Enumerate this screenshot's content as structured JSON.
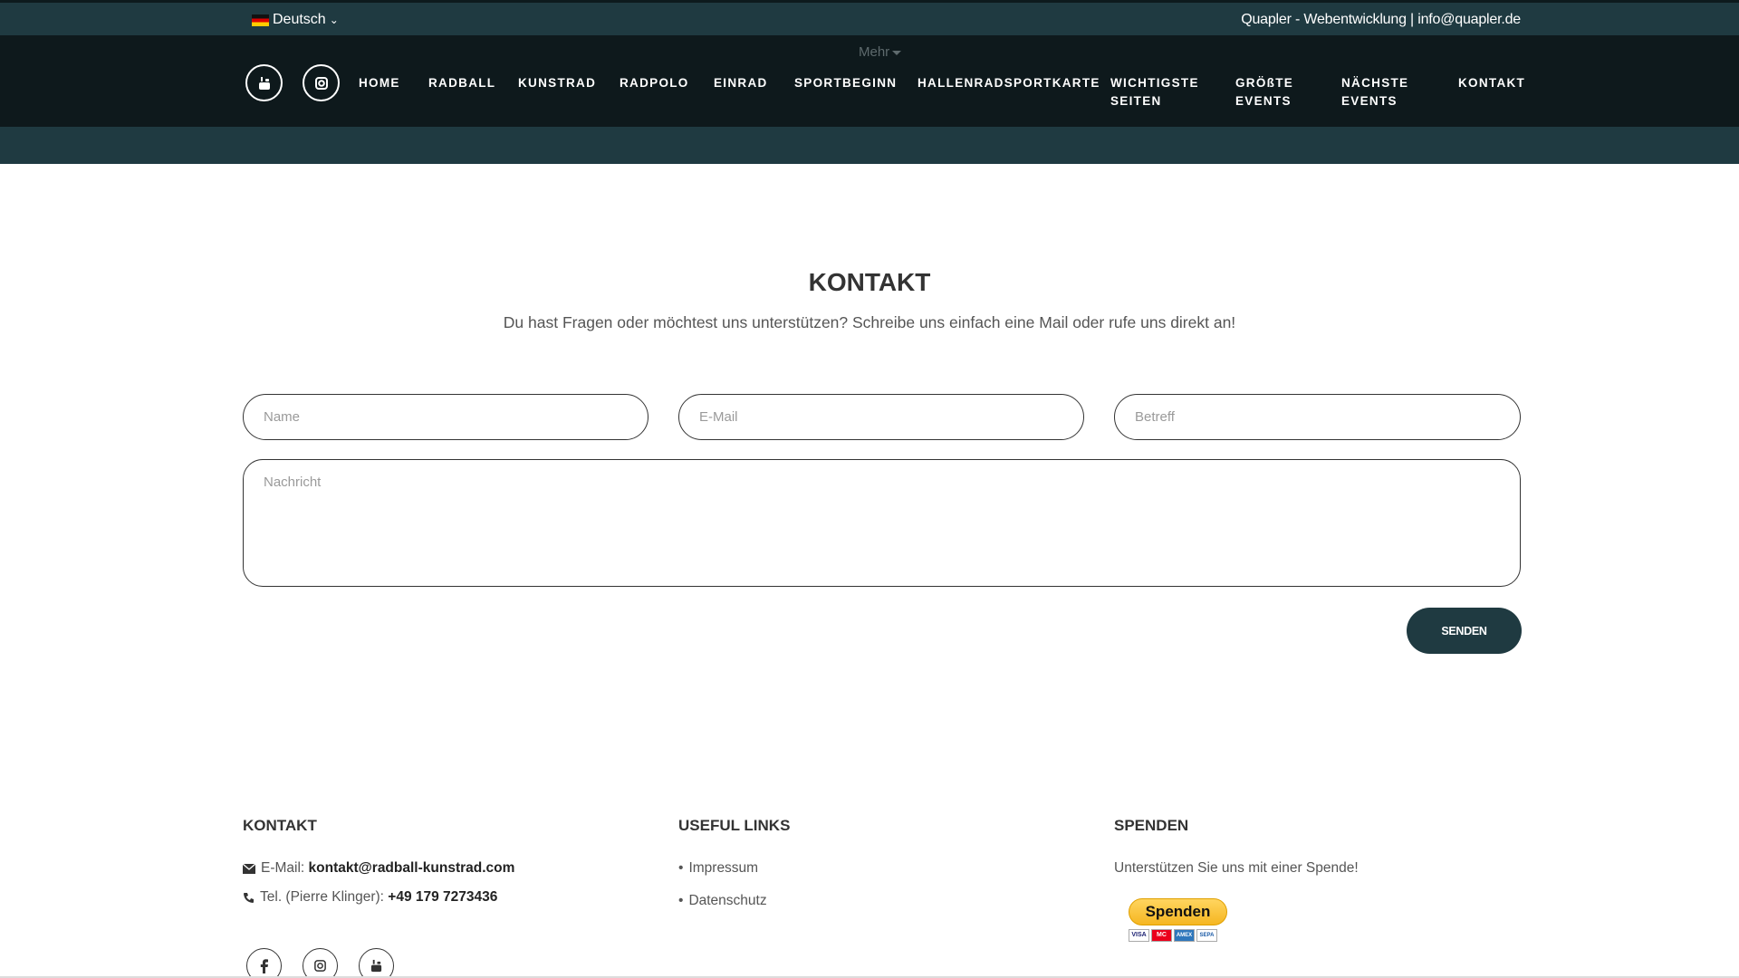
{
  "topbar": {
    "language": "Deutsch",
    "info": "Quapler - Webentwicklung | info@quapler.de"
  },
  "nav": {
    "more": "Mehr",
    "items": [
      {
        "label": "HOME"
      },
      {
        "label": "RADBALL"
      },
      {
        "label": "KUNSTRAD"
      },
      {
        "label": "RADPOLO"
      },
      {
        "label": "EINRAD"
      },
      {
        "label": "SPORTBEGINN"
      },
      {
        "label": "HALLENRADSPORTKARTE"
      },
      {
        "label": "WICHTIGSTE SEITEN"
      },
      {
        "label": "GRÖßTE EVENTS"
      },
      {
        "label": "NÄCHSTE EVENTS"
      },
      {
        "label": "KONTAKT"
      }
    ],
    "icons": [
      "youtube-icon",
      "instagram-icon"
    ]
  },
  "contact": {
    "title": "KONTAKT",
    "subtitle": "Du hast Fragen oder möchtest uns unterstützen? Schreibe uns einfach eine Mail oder rufe uns direkt an!",
    "name_placeholder": "Name",
    "email_placeholder": "E-Mail",
    "subject_placeholder": "Betreff",
    "message_placeholder": "Nachricht",
    "send_label": "SENDEN"
  },
  "footer": {
    "contact_heading": "KONTAKT",
    "email_label": "E-Mail: ",
    "email_value": "kontakt@radball-kunstrad.com",
    "phone_label": "Tel. (Pierre Klinger): ",
    "phone_value": "+49 179 7273436",
    "links_heading": "USEFUL LINKS",
    "links": [
      "Impressum",
      "Datenschutz"
    ],
    "donate_heading": "SPENDEN",
    "donate_text": "Unterstützen Sie uns mit einer Spende!",
    "donate_button": "Spenden",
    "cards": [
      "VISA",
      "MC",
      "AMEX",
      "SEPA"
    ],
    "social_icons": [
      "facebook-icon",
      "instagram-icon",
      "youtube-icon"
    ]
  },
  "colors": {
    "primary": "#1f3a41",
    "nav_bg": "#0e191c",
    "paypal": "#f5b622"
  }
}
